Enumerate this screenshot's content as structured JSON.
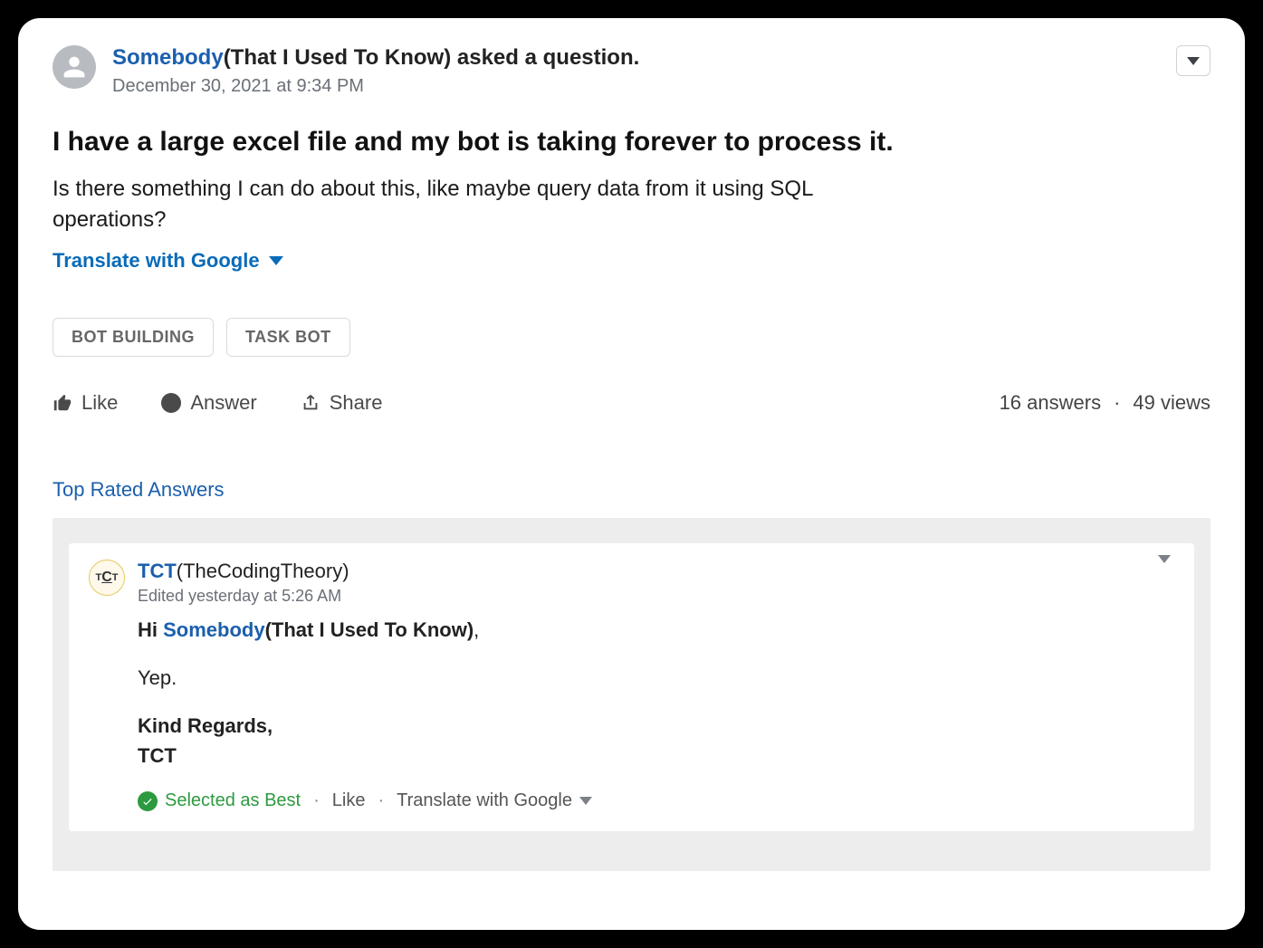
{
  "question": {
    "asker_name": "Somebody",
    "asker_subtitle": "(That I Used To Know)",
    "asked_suffix": " asked a question.",
    "date": "December 30, 2021 at 9:34 PM",
    "title": "I have a large excel file and my bot is taking forever to process it.",
    "body": "Is there something I can do about this, like maybe query data from it using SQL operations?",
    "translate_label": "Translate with Google",
    "tags": [
      "BOT BUILDING",
      "TASK BOT"
    ]
  },
  "actions": {
    "like": "Like",
    "answer": "Answer",
    "share": "Share"
  },
  "stats": {
    "answers": "16 answers",
    "views": "49 views",
    "separator": "·"
  },
  "section_label": "Top Rated Answers",
  "answer": {
    "tct_avatar_letters": "TCT",
    "author_name": "TCT",
    "author_subtitle": "(TheCodingTheory)",
    "edited_line": "Edited yesterday at 5:26 AM",
    "greeting_prefix": "Hi ",
    "mention_name": "Somebody",
    "mention_subtitle": "(That I Used To Know)",
    "mention_trailing": ",",
    "body_line": "Yep.",
    "signoff_line1": "Kind Regards,",
    "signoff_line2": "TCT",
    "selected_best": "Selected as Best",
    "like": "Like",
    "translate": "Translate with Google"
  }
}
